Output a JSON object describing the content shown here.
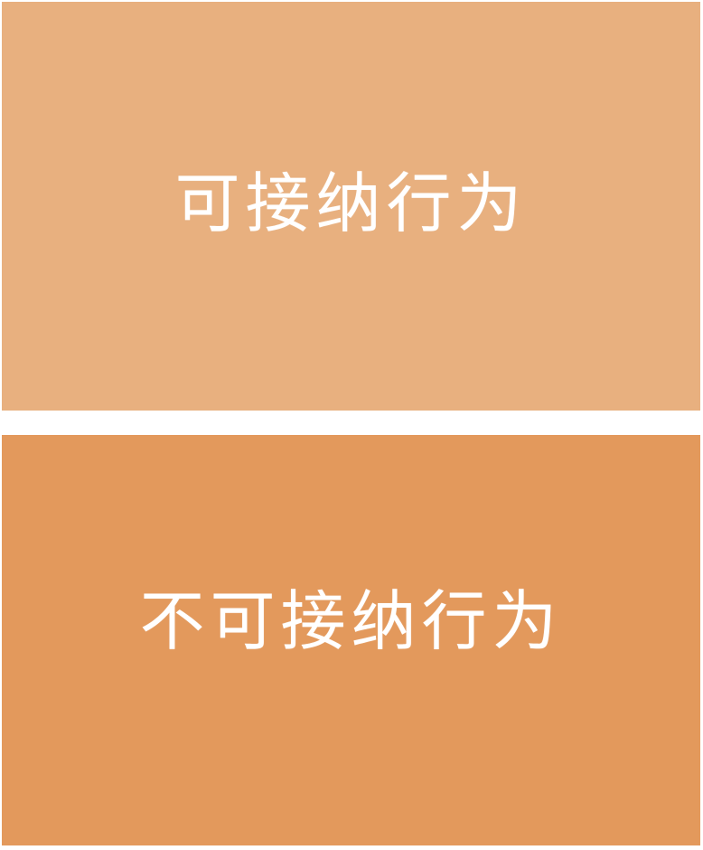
{
  "panels": [
    {
      "label": "可接纳行为",
      "background": "#E8B07F"
    },
    {
      "label": "不可接纳行为",
      "background": "#E3995C"
    }
  ],
  "colors": {
    "page_background": "#FFFFFF",
    "text": "#FFFFFF"
  }
}
